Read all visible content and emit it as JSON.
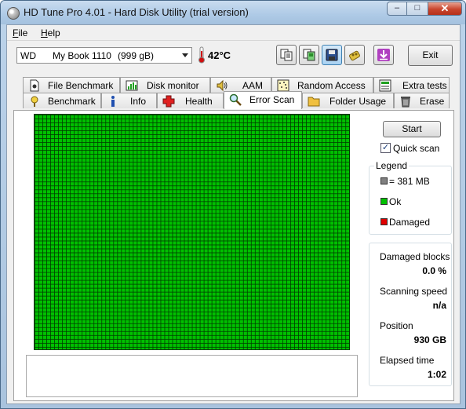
{
  "window": {
    "title": "HD Tune Pro 4.01 - Hard Disk Utility (trial version)",
    "caption_buttons": {
      "minimize": "–",
      "maximize": "□",
      "close": "✕"
    }
  },
  "menu": [
    {
      "label": "File",
      "accel": "F",
      "rest": "ile"
    },
    {
      "label": "Help",
      "accel": "H",
      "rest": "elp"
    }
  ],
  "drive": {
    "brand": "WD",
    "model": "My Book 1110",
    "capacity": "(999 gB)"
  },
  "temperature": "42°C",
  "toolbar": {
    "icons": [
      "copy-text-icon",
      "copy-screenshot-icon",
      "save-icon",
      "options-icon",
      "download-icon"
    ],
    "exit_label": "Exit"
  },
  "tabs": {
    "row1": [
      {
        "label": "File Benchmark",
        "icon": "file-benchmark-icon"
      },
      {
        "label": "Disk monitor",
        "icon": "disk-monitor-icon"
      },
      {
        "label": "AAM",
        "icon": "aam-speaker-icon"
      },
      {
        "label": "Random Access",
        "icon": "random-access-icon"
      },
      {
        "label": "Extra tests",
        "icon": "extra-tests-icon"
      }
    ],
    "row2": [
      {
        "label": "Benchmark",
        "icon": "benchmark-icon"
      },
      {
        "label": "Info",
        "icon": "info-icon"
      },
      {
        "label": "Health",
        "icon": "health-cross-icon"
      },
      {
        "label": "Error Scan",
        "icon": "error-scan-magnifier-icon",
        "active": true
      },
      {
        "label": "Folder Usage",
        "icon": "folder-icon"
      },
      {
        "label": "Erase",
        "icon": "erase-trash-icon"
      }
    ]
  },
  "scan": {
    "start_label": "Start",
    "quick_scan_label": "Quick scan",
    "quick_scan_checked": true,
    "block_status": "all ok",
    "legend": {
      "title": "Legend",
      "items": [
        {
          "label": "= 381 MB",
          "color": "#808080"
        },
        {
          "label": "Ok",
          "color": "#00c000"
        },
        {
          "label": "Damaged",
          "color": "#e00000"
        }
      ]
    },
    "stats": {
      "damaged_blocks_label": "Damaged blocks",
      "damaged_blocks_value": "0.0 %",
      "scanning_speed_label": "Scanning speed",
      "scanning_speed_value": "n/a",
      "position_label": "Position",
      "position_value": "930 GB",
      "elapsed_label": "Elapsed time",
      "elapsed_value": "1:02"
    }
  },
  "colors": {
    "ok_green": "#00c000",
    "grid_line": "#003d00",
    "titlebar": "#aecae6"
  }
}
